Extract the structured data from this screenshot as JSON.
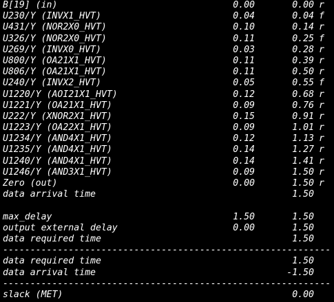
{
  "report": {
    "lines": [
      {
        "type": "row",
        "label": "B[19] (in)",
        "incr": "0.00",
        "path": "0.00",
        "edge": "r"
      },
      {
        "type": "row",
        "label": "U230/Y (INVX1_HVT)",
        "incr": "0.04",
        "path": "0.04",
        "edge": "f"
      },
      {
        "type": "row",
        "label": "U431/Y (NOR2X0_HVT)",
        "incr": "0.10",
        "path": "0.14",
        "edge": "r"
      },
      {
        "type": "row",
        "label": "U326/Y (NOR2X0_HVT)",
        "incr": "0.11",
        "path": "0.25",
        "edge": "f"
      },
      {
        "type": "row",
        "label": "U269/Y (INVX0_HVT)",
        "incr": "0.03",
        "path": "0.28",
        "edge": "r"
      },
      {
        "type": "row",
        "label": "U800/Y (OA21X1_HVT)",
        "incr": "0.11",
        "path": "0.39",
        "edge": "r"
      },
      {
        "type": "row",
        "label": "U806/Y (OA21X1_HVT)",
        "incr": "0.11",
        "path": "0.50",
        "edge": "r"
      },
      {
        "type": "row",
        "label": "U240/Y (INVX2_HVT)",
        "incr": "0.05",
        "path": "0.55",
        "edge": "f"
      },
      {
        "type": "row",
        "label": "U1220/Y (AOI21X1_HVT)",
        "incr": "0.12",
        "path": "0.68",
        "edge": "r"
      },
      {
        "type": "row",
        "label": "U1221/Y (OA21X1_HVT)",
        "incr": "0.09",
        "path": "0.76",
        "edge": "r"
      },
      {
        "type": "row",
        "label": "U222/Y (XNOR2X1_HVT)",
        "incr": "0.15",
        "path": "0.91",
        "edge": "r"
      },
      {
        "type": "row",
        "label": "U1223/Y (OA22X1_HVT)",
        "incr": "0.09",
        "path": "1.01",
        "edge": "r"
      },
      {
        "type": "row",
        "label": "U1234/Y (AND4X1_HVT)",
        "incr": "0.12",
        "path": "1.13",
        "edge": "r"
      },
      {
        "type": "row",
        "label": "U1235/Y (AND4X1_HVT)",
        "incr": "0.14",
        "path": "1.27",
        "edge": "r"
      },
      {
        "type": "row",
        "label": "U1240/Y (AND4X1_HVT)",
        "incr": "0.14",
        "path": "1.41",
        "edge": "r"
      },
      {
        "type": "row",
        "label": "U1246/Y (AND3X1_HVT)",
        "incr": "0.09",
        "path": "1.50",
        "edge": "r"
      },
      {
        "type": "row",
        "label": "Zero (out)",
        "incr": "0.00",
        "path": "1.50",
        "edge": "r"
      },
      {
        "type": "row",
        "label": "data arrival time",
        "incr": "",
        "path": "1.50",
        "edge": ""
      },
      {
        "type": "blank"
      },
      {
        "type": "row",
        "label": "max_delay",
        "incr": "1.50",
        "path": "1.50",
        "edge": ""
      },
      {
        "type": "row",
        "label": "output external delay",
        "incr": "0.00",
        "path": "1.50",
        "edge": ""
      },
      {
        "type": "row",
        "label": "data required time",
        "incr": "",
        "path": "1.50",
        "edge": ""
      },
      {
        "type": "separator",
        "text": "-----------------------------------------------------------------"
      },
      {
        "type": "row",
        "label": "data required time",
        "incr": "",
        "path": "1.50",
        "edge": ""
      },
      {
        "type": "row",
        "label": "data arrival time",
        "incr": "",
        "path": "-1.50",
        "edge": ""
      },
      {
        "type": "separator",
        "text": "-----------------------------------------------------------------"
      },
      {
        "type": "row",
        "label": "slack (MET)",
        "incr": "",
        "path": "0.00",
        "edge": ""
      }
    ]
  }
}
